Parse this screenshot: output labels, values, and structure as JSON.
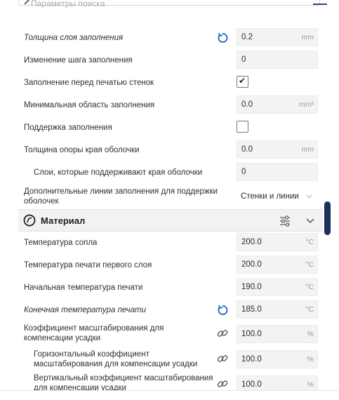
{
  "search": {
    "placeholder": "Параметры поиска"
  },
  "settings_top": [
    {
      "label": "Толщина слоя заполнения",
      "value": "0.2",
      "unit": "mm"
    },
    {
      "label": "Изменение шага заполнения",
      "value": "0"
    },
    {
      "label": "Заполнение перед печатью стенок",
      "checked": true
    },
    {
      "label": "Минимальная область заполнения",
      "value": "0.0",
      "unit": "mm²"
    },
    {
      "label": "Поддержка заполнения",
      "checked": false
    },
    {
      "label": "Толщина опоры края оболочки",
      "value": "0.0",
      "unit": "mm"
    },
    {
      "label": "Слои, которые поддерживают края оболочки",
      "value": "0"
    },
    {
      "label_line1": "Дополнительные линии заполнения для поддержки",
      "label_line2": "оболочек",
      "value": "Стенки и линии"
    }
  ],
  "section": {
    "title": "Материал"
  },
  "settings_material": [
    {
      "label": "Температура сопла",
      "value": "200.0",
      "unit": "°C"
    },
    {
      "label": "Температура печати первого слоя",
      "value": "200.0",
      "unit": "°C"
    },
    {
      "label": "Начальная температура печати",
      "value": "190.0",
      "unit": "°C"
    },
    {
      "label": "Конечная температура печати",
      "value": "185.0",
      "unit": "°C"
    },
    {
      "label_line1": "Коэффициент масштабирования для",
      "label_line2": "компенсации усадки",
      "value": "100.0",
      "unit": "%"
    },
    {
      "label_line1": "Горизонтальный коэффициент",
      "label_line2": "масштабирования для компенсации усадки",
      "value": "100.0",
      "unit": "%"
    },
    {
      "label_line1": "Вертикальный коэффициент масштабирования",
      "label_line2": "для компенсации усадки",
      "value": "100.0",
      "unit": "%"
    }
  ],
  "colors": {
    "accent": "#1e63c4",
    "scrollbar": "#1f2f5c"
  },
  "icons": {
    "reset": "reset-icon",
    "link": "link-icon",
    "filter": "settings-sliders-icon",
    "collapse": "chevron-down-icon",
    "material": "material-icon"
  }
}
